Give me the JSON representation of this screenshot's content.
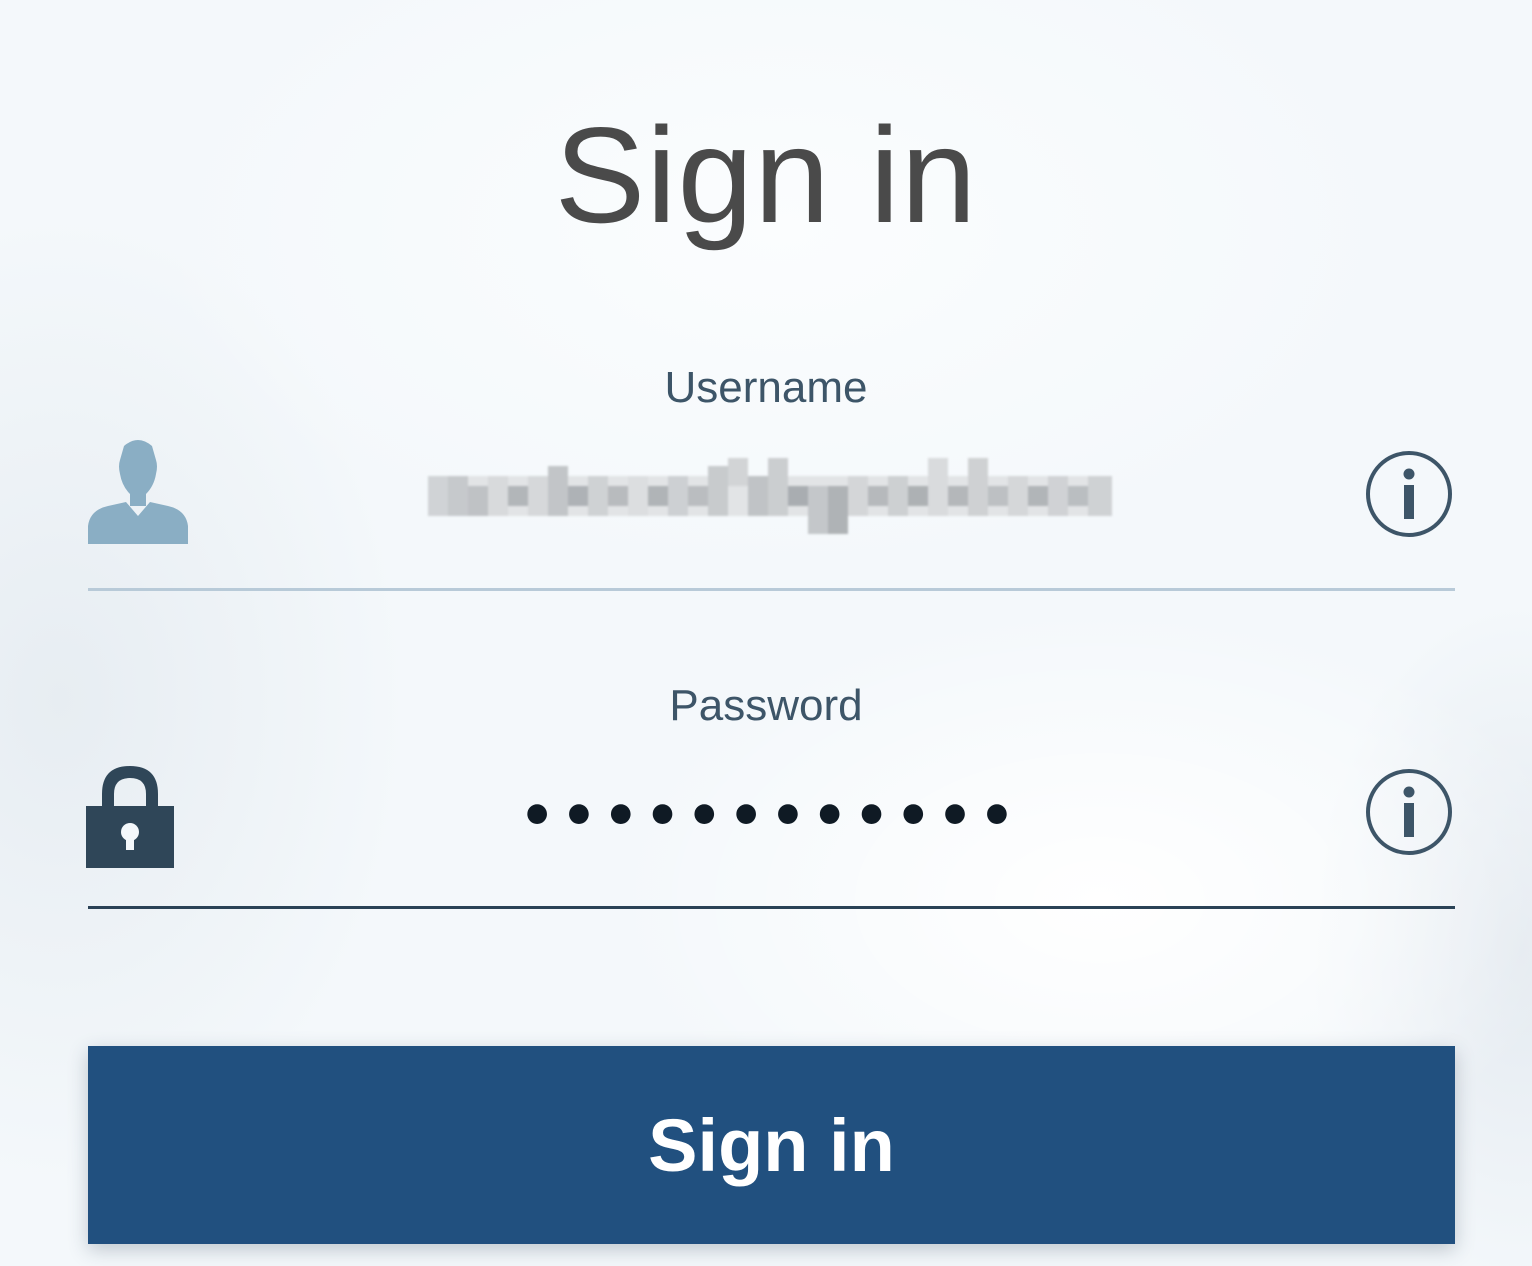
{
  "header": {
    "title": "Sign in"
  },
  "form": {
    "username": {
      "label": "Username",
      "value": "(redacted)",
      "icon": "user-icon",
      "info_icon": "info-icon"
    },
    "password": {
      "label": "Password",
      "value": "••••••••••••",
      "icon": "lock-icon",
      "info_icon": "info-icon"
    },
    "submit_label": "Sign in"
  },
  "colors": {
    "button_bg": "#21507f",
    "button_text": "#ffffff",
    "title_text": "#4a4a4a",
    "label_text": "#3d5568",
    "user_icon": "#8aaec4",
    "lock_icon": "#2f4658",
    "underline_inactive": "#b8cad8",
    "underline_active": "#2a4256"
  }
}
